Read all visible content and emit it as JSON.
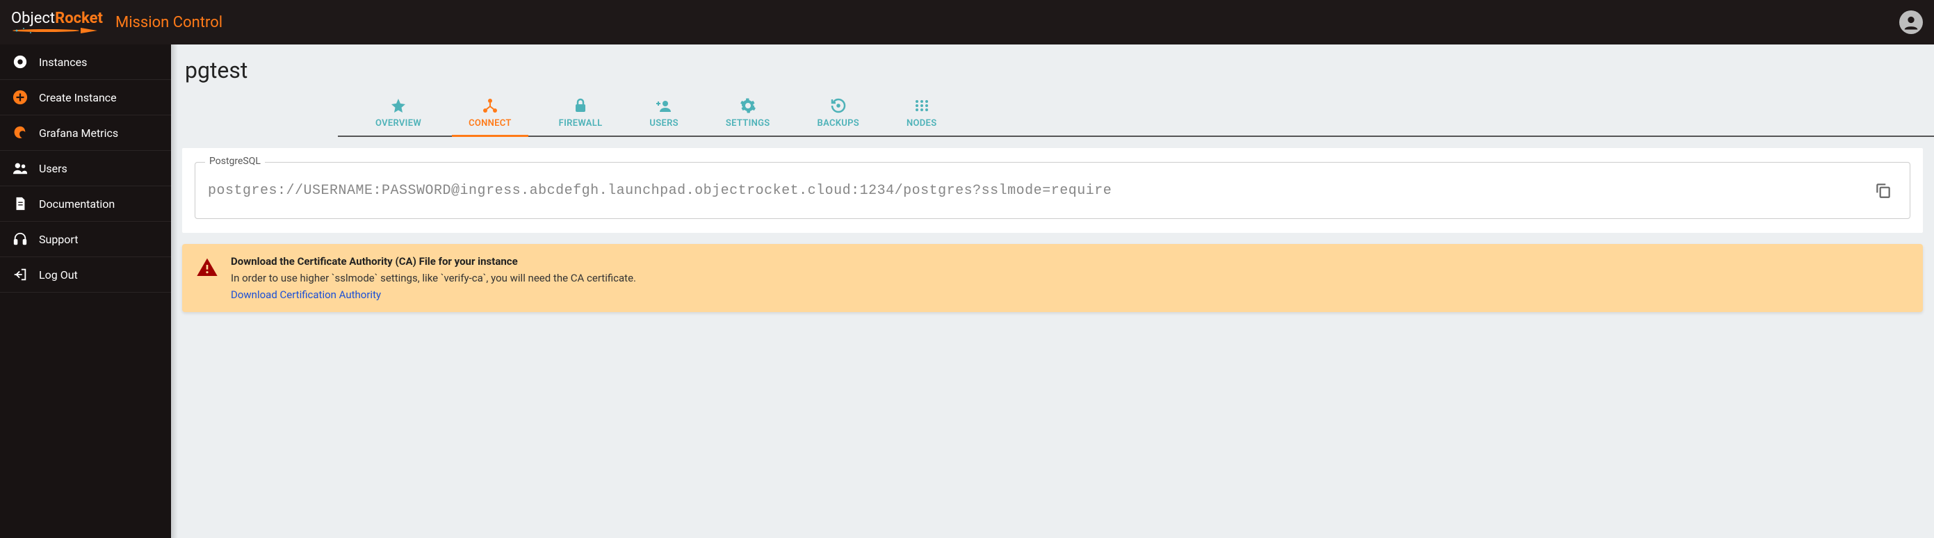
{
  "header": {
    "brand": "Mission Control"
  },
  "sidebar": {
    "items": [
      {
        "label": "Instances"
      },
      {
        "label": "Create Instance"
      },
      {
        "label": "Grafana Metrics"
      },
      {
        "label": "Users"
      },
      {
        "label": "Documentation"
      },
      {
        "label": "Support"
      },
      {
        "label": "Log Out"
      }
    ]
  },
  "page": {
    "title": "pgtest"
  },
  "tabs": [
    {
      "label": "OVERVIEW"
    },
    {
      "label": "CONNECT"
    },
    {
      "label": "FIREWALL"
    },
    {
      "label": "USERS"
    },
    {
      "label": "SETTINGS"
    },
    {
      "label": "BACKUPS"
    },
    {
      "label": "NODES"
    }
  ],
  "connection": {
    "legend": "PostgreSQL",
    "string": "postgres://USERNAME:PASSWORD@ingress.abcdefgh.launchpad.objectrocket.cloud:1234/postgres?sslmode=require"
  },
  "alert": {
    "title": "Download the Certificate Authority (CA) File for your instance",
    "body": "In order to use higher `sslmode` settings, like `verify-ca`, you will need the CA certificate.",
    "link": "Download Certification Authority"
  }
}
